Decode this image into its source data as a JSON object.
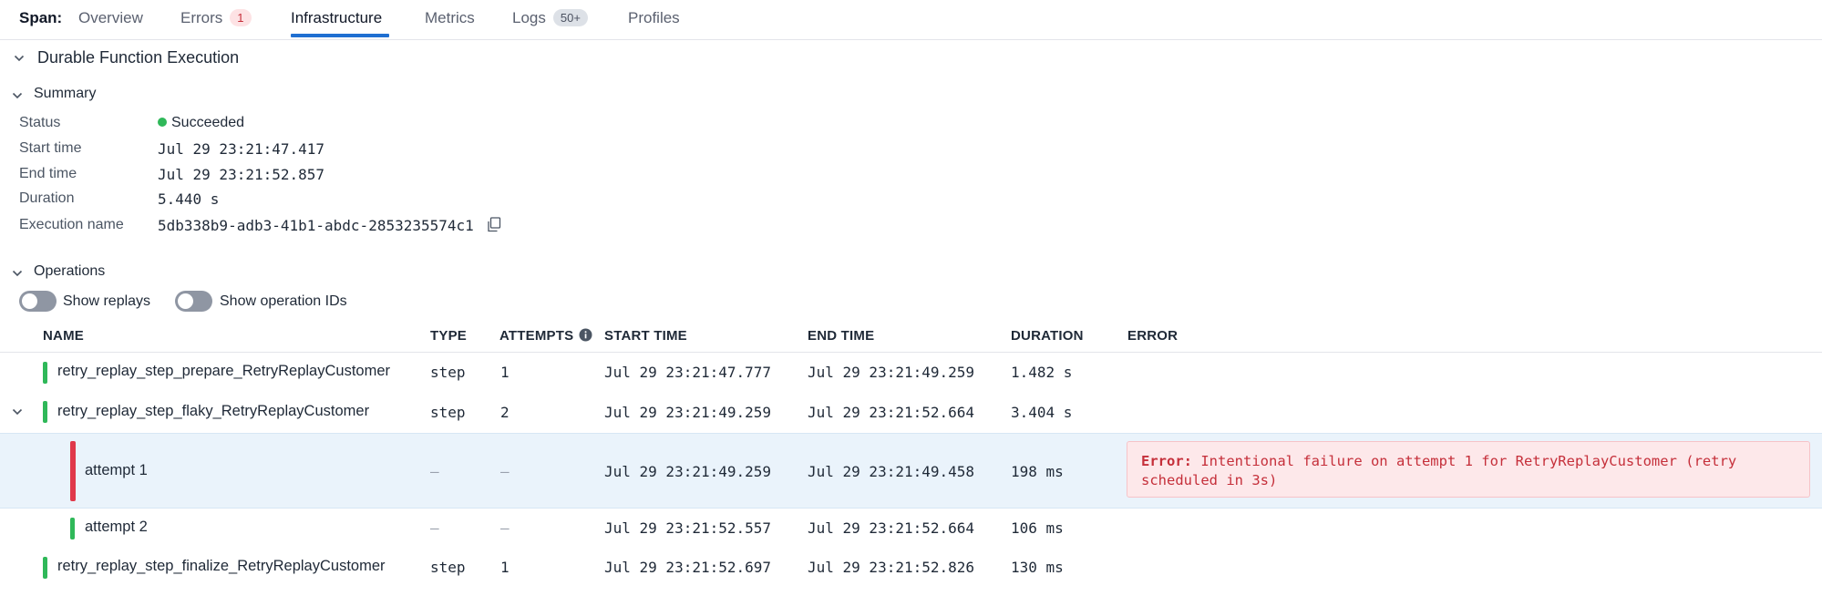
{
  "tabs": {
    "span_label": "Span:",
    "items": [
      {
        "label": "Overview"
      },
      {
        "label": "Errors",
        "badge": "1"
      },
      {
        "label": "Infrastructure",
        "active": true
      },
      {
        "label": "Metrics"
      },
      {
        "label": "Logs",
        "badge": "50+"
      },
      {
        "label": "Profiles"
      }
    ]
  },
  "execution": {
    "title": "Durable Function Execution",
    "summary_title": "Summary",
    "fields": {
      "status_label": "Status",
      "status_value": "Succeeded",
      "start_label": "Start time",
      "start_value": "Jul 29 23:21:47.417",
      "end_label": "End time",
      "end_value": "Jul 29 23:21:52.857",
      "duration_label": "Duration",
      "duration_value": "5.440 s",
      "name_label": "Execution name",
      "name_value": "5db338b9-adb3-41b1-abdc-2853235574c1"
    }
  },
  "operations": {
    "title": "Operations",
    "toggles": {
      "show_replays": "Show replays",
      "show_operation_ids": "Show operation IDs"
    },
    "columns": {
      "name": "NAME",
      "type": "TYPE",
      "attempts": "ATTEMPTS",
      "start": "START TIME",
      "end": "END TIME",
      "duration": "DURATION",
      "error": "ERROR"
    },
    "rows": [
      {
        "name": "retry_replay_step_prepare_RetryReplayCustomer",
        "type": "step",
        "attempts": "1",
        "start": "Jul 29 23:21:47.777",
        "end": "Jul 29 23:21:49.259",
        "duration": "1.482 s",
        "status": "ok"
      },
      {
        "name": "retry_replay_step_flaky_RetryReplayCustomer",
        "type": "step",
        "attempts": "2",
        "start": "Jul 29 23:21:49.259",
        "end": "Jul 29 23:21:52.664",
        "duration": "3.404 s",
        "status": "ok",
        "expanded": true
      },
      {
        "name": "attempt 1",
        "type": "—",
        "attempts": "—",
        "start": "Jul 29 23:21:49.259",
        "end": "Jul 29 23:21:49.458",
        "duration": "198 ms",
        "status": "error",
        "error_prefix": "Error:",
        "error_message": "Intentional failure on attempt 1 for RetryReplayCustomer (retry",
        "error_message_2": "scheduled in 3s)"
      },
      {
        "name": "attempt 2",
        "type": "—",
        "attempts": "—",
        "start": "Jul 29 23:21:52.557",
        "end": "Jul 29 23:21:52.664",
        "duration": "106 ms",
        "status": "ok"
      },
      {
        "name": "retry_replay_step_finalize_RetryReplayCustomer",
        "type": "step",
        "attempts": "1",
        "start": "Jul 29 23:21:52.697",
        "end": "Jul 29 23:21:52.826",
        "duration": "130 ms",
        "status": "ok"
      }
    ]
  },
  "colors": {
    "accent": "#1f6fd1",
    "success": "#2fb859",
    "error": "#e0384a",
    "row_highlight": "#eaf3fb"
  }
}
